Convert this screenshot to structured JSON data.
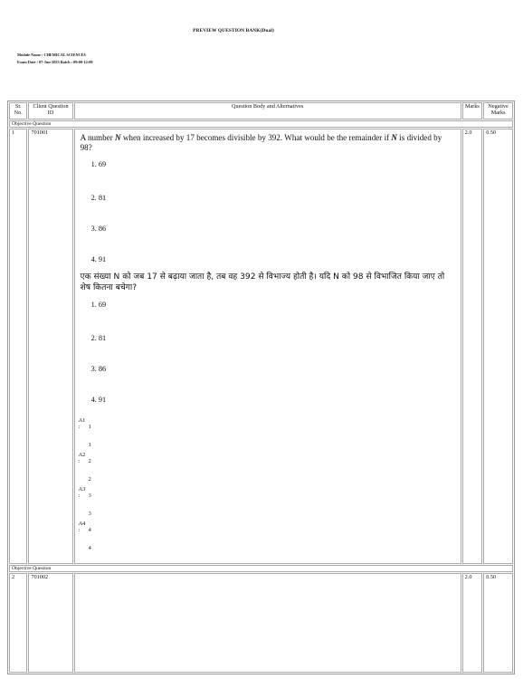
{
  "header": {
    "title": "PREVIEW QUESTION BANK(Dual)",
    "module": "Module Name : CHEMICAL SCIENCES",
    "exam": "Exam Date : 07-Jun-2023   Batch : 09:00-12:00"
  },
  "table": {
    "columns": {
      "sr": "Sr. No.",
      "client": "Client Question ID",
      "body": "Question Body and Alternatives",
      "marks": "Marks",
      "neg": "Negative Marks"
    },
    "section_label": "Objective Question",
    "questions": [
      {
        "sr": "1",
        "id": "701001",
        "marks": "2.0",
        "neg": "0.50",
        "stem_en_before": "A number ",
        "var": "N",
        "stem_en_mid": " when increased by 17 becomes divisible by 392. What would be the remainder if ",
        "stem_en_after": " is divided by 98?",
        "options_en": [
          "1. 69",
          "2. 81",
          "3. 86",
          "4. 91"
        ],
        "stem_hi": "एक संख्या N को जब 17 से बढ़ाया जाता है, तब वह 392 से विभाज्य होती है। यदि N को 98 से विभाजित किया जाए तो शेष कितना बचेगा?",
        "options_hi": [
          "1. 69",
          "2. 81",
          "3. 86",
          "4. 91"
        ],
        "answers": [
          {
            "label": "A1",
            "colon": ":",
            "v": "1",
            "v2": "1"
          },
          {
            "label": "A2",
            "colon": ":",
            "v": "2",
            "v2": "2"
          },
          {
            "label": "A3",
            "colon": ":",
            "v": "3",
            "v2": "3"
          },
          {
            "label": "A4",
            "colon": ":",
            "v": "4",
            "v2": "4"
          }
        ]
      },
      {
        "sr": "2",
        "id": "701002",
        "marks": "2.0",
        "neg": "0.50"
      }
    ]
  }
}
